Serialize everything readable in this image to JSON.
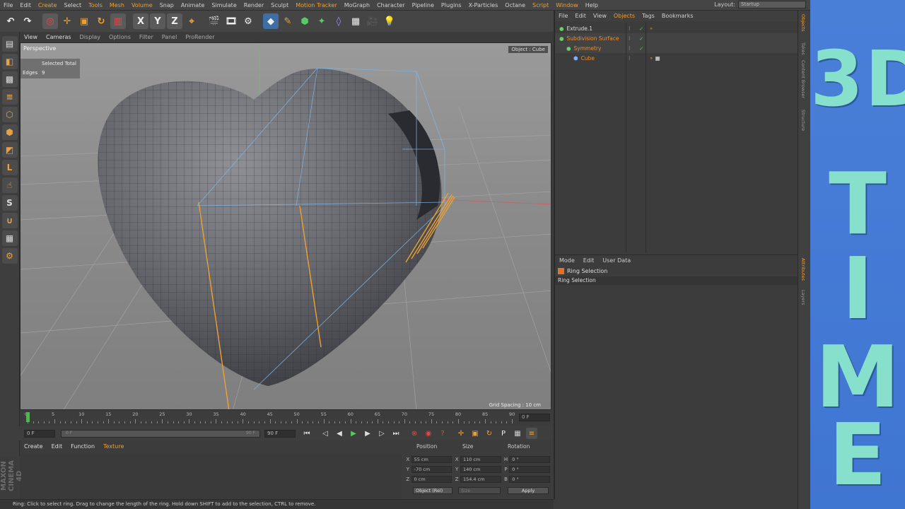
{
  "menubar": {
    "items": [
      {
        "label": "File",
        "hl": false
      },
      {
        "label": "Edit",
        "hl": false
      },
      {
        "label": "Create",
        "hl": true
      },
      {
        "label": "Select",
        "hl": false
      },
      {
        "label": "Tools",
        "hl": true
      },
      {
        "label": "Mesh",
        "hl": true
      },
      {
        "label": "Volume",
        "hl": true
      },
      {
        "label": "Snap",
        "hl": false
      },
      {
        "label": "Animate",
        "hl": false
      },
      {
        "label": "Simulate",
        "hl": false
      },
      {
        "label": "Render",
        "hl": false
      },
      {
        "label": "Sculpt",
        "hl": false
      },
      {
        "label": "Motion Tracker",
        "hl": true
      },
      {
        "label": "MoGraph",
        "hl": false
      },
      {
        "label": "Character",
        "hl": false
      },
      {
        "label": "Pipeline",
        "hl": false
      },
      {
        "label": "Plugins",
        "hl": false
      },
      {
        "label": "X-Particles",
        "hl": false
      },
      {
        "label": "Octane",
        "hl": false
      },
      {
        "label": "Script",
        "hl": true
      },
      {
        "label": "Window",
        "hl": true
      },
      {
        "label": "Help",
        "hl": false
      }
    ],
    "layout_label": "Layout:",
    "layout_value": "Startup"
  },
  "viewport": {
    "menu": [
      "View",
      "Cameras",
      "Display",
      "Options",
      "Filter",
      "Panel",
      "ProRender"
    ],
    "label": "Perspective",
    "object": "Object : Cube",
    "stats_header": "Selected Total",
    "stats_label": "Edges",
    "stats_value": "9",
    "grid_spacing": "Grid Spacing : 10 cm"
  },
  "timeline": {
    "ticks": [
      "0",
      "5",
      "10",
      "15",
      "20",
      "25",
      "30",
      "35",
      "40",
      "45",
      "50",
      "55",
      "60",
      "65",
      "70",
      "75",
      "80",
      "85",
      "90"
    ],
    "current_frame": "0 F",
    "start": "0 F",
    "range_left": "0 F",
    "range_right": "90 F",
    "end": "90 F",
    "right_field": "0 F"
  },
  "material": {
    "menu": [
      "Create",
      "Edit",
      "Function",
      "Texture"
    ]
  },
  "coords": {
    "headers": [
      "Position",
      "Size",
      "Rotation"
    ],
    "rows": [
      {
        "axis": "X",
        "pos": "55 cm",
        "saxis": "X",
        "size": "110 cm",
        "raxis": "H",
        "rot": "0 °"
      },
      {
        "axis": "Y",
        "pos": "-70 cm",
        "saxis": "Y",
        "size": "140 cm",
        "raxis": "P",
        "rot": "0 °"
      },
      {
        "axis": "Z",
        "pos": "0 cm",
        "saxis": "Z",
        "size": "154.4 cm",
        "raxis": "B",
        "rot": "0 °"
      }
    ],
    "mode": "Object (Rel)",
    "size_mode": "Size",
    "apply": "Apply"
  },
  "status": "Ring: Click to select ring. Drag to change the length of the ring. Hold down SHIFT to add to the selection, CTRL to remove.",
  "objects": {
    "menu": [
      {
        "label": "File",
        "hl": false
      },
      {
        "label": "Edit",
        "hl": false
      },
      {
        "label": "View",
        "hl": false
      },
      {
        "label": "Objects",
        "hl": true
      },
      {
        "label": "Tags",
        "hl": false
      },
      {
        "label": "Bookmarks",
        "hl": false
      }
    ],
    "tree": [
      {
        "name": "Extrude.1",
        "indent": 0,
        "color": "white"
      },
      {
        "name": "Subdivision Surface",
        "indent": 0,
        "color": "orange"
      },
      {
        "name": "Symmetry",
        "indent": 1,
        "color": "orange"
      },
      {
        "name": "Cube",
        "indent": 2,
        "color": "orange"
      }
    ]
  },
  "attributes": {
    "menu": [
      "Mode",
      "Edit",
      "User Data"
    ],
    "title": "Ring Selection",
    "tab": "Ring Selection"
  },
  "sidetabs": [
    "Objects",
    "Takes",
    "Content Browser",
    "Structure",
    "Attributes",
    "Layers"
  ],
  "overlay": {
    "line1": "3D",
    "line2": "T",
    "line3": "I",
    "line4": "M",
    "line5": "E"
  },
  "branding": "MAXON CINEMA 4D"
}
